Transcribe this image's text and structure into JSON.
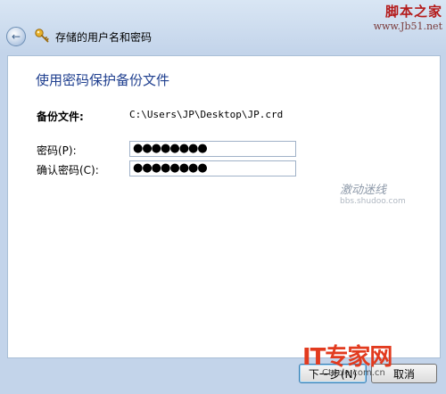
{
  "window": {
    "title": "存储的用户名和密码"
  },
  "watermarks": {
    "top_right_line1": "脚本之家",
    "top_right_line2": "www.Jb51.net",
    "middle_line1": "激动迷线",
    "middle_line2": "bbs.shudoo.com",
    "logo_line1": "IT专家网",
    "logo_line2": "Ctocio.com.cn"
  },
  "main": {
    "heading": "使用密码保护备份文件",
    "file_label": "备份文件:",
    "file_value": "C:\\Users\\JP\\Desktop\\JP.crd",
    "password_label": "密码(P):",
    "password_value": "●●●●●●●●",
    "confirm_label": "确认密码(C):",
    "confirm_value": "●●●●●●●●"
  },
  "buttons": {
    "next_label": "下一步(N)",
    "cancel_label": "取消"
  },
  "colors": {
    "heading": "#1f3f8f",
    "frame": "#c3d4ea",
    "brand_red": "#e23b1f"
  },
  "icons": {
    "back": "back-arrow-icon",
    "key": "key-icon"
  }
}
